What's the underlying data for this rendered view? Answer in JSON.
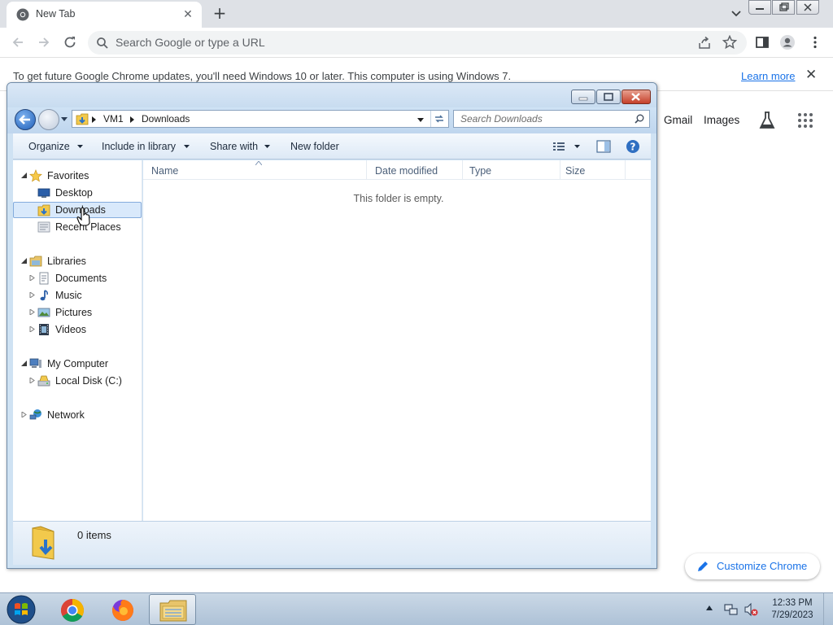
{
  "chrome": {
    "tab_title": "New Tab",
    "omnibox_placeholder": "Search Google or type a URL",
    "infobar": {
      "message": "To get future Google Chrome updates, you'll need Windows 10 or later. This computer is using Windows 7.",
      "link": "Learn more"
    },
    "ntp_links": [
      "Gmail",
      "Images"
    ],
    "customize_label": "Customize Chrome",
    "accent": "#1a73e8"
  },
  "explorer": {
    "breadcrumbs": [
      "VM1",
      "Downloads"
    ],
    "search_placeholder": "Search Downloads",
    "commands": {
      "organize": "Organize",
      "include_in_library": "Include in library",
      "share_with": "Share with",
      "new_folder": "New folder"
    },
    "nav": {
      "favorites": {
        "label": "Favorites",
        "items": [
          "Desktop",
          "Downloads",
          "Recent Places"
        ]
      },
      "libraries": {
        "label": "Libraries",
        "items": [
          "Documents",
          "Music",
          "Pictures",
          "Videos"
        ]
      },
      "computer": {
        "label": "My Computer",
        "items": [
          "Local Disk (C:)"
        ]
      },
      "network": {
        "label": "Network"
      },
      "selected": "Downloads"
    },
    "columns": [
      "Name",
      "Date modified",
      "Type",
      "Size"
    ],
    "empty_message": "This folder is empty.",
    "item_count": "0 items"
  },
  "taskbar": {
    "apps": [
      "chrome-icon",
      "firefox-icon",
      "explorer-icon"
    ],
    "active_app": "explorer-icon",
    "time": "12:33 PM",
    "date": "7/29/2023"
  }
}
